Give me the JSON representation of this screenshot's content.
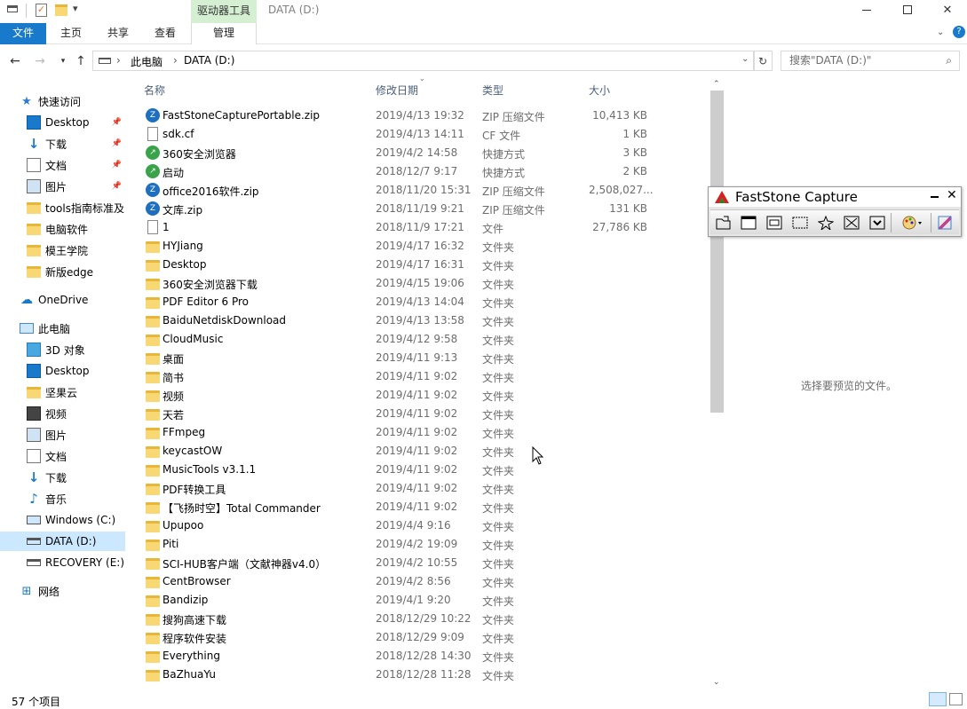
{
  "window": {
    "title": "DATA (D:)",
    "context_tab": "驱动器工具",
    "controls": {
      "minimize": "—",
      "maximize": "☐",
      "close": "✕"
    }
  },
  "ribbon": {
    "tabs": [
      "文件",
      "主页",
      "共享",
      "查看",
      "管理"
    ],
    "accent": "#1979ca"
  },
  "address": {
    "path": [
      "此电脑",
      "DATA (D:)"
    ],
    "search_placeholder": "搜索\"DATA (D:)\""
  },
  "nav": {
    "items": [
      {
        "label": "快速访问",
        "icon": "star-icon"
      },
      {
        "label": "Desktop",
        "icon": "desktop-icon",
        "pinned": true
      },
      {
        "label": "下载",
        "icon": "download-icon",
        "pinned": true
      },
      {
        "label": "文档",
        "icon": "document-icon",
        "pinned": true
      },
      {
        "label": "图片",
        "icon": "picture-icon",
        "pinned": true
      },
      {
        "label": "tools指南标准及",
        "icon": "folder-icon"
      },
      {
        "label": "电脑软件",
        "icon": "folder-icon"
      },
      {
        "label": "模王学院",
        "icon": "folder-icon"
      },
      {
        "label": "新版edge",
        "icon": "folder-icon"
      },
      {
        "label": "OneDrive",
        "icon": "cloud-icon"
      },
      {
        "label": "此电脑",
        "icon": "computer-icon"
      },
      {
        "label": "3D 对象",
        "icon": "cube-icon"
      },
      {
        "label": "Desktop",
        "icon": "desktop-icon"
      },
      {
        "label": "坚果云",
        "icon": "folder-icon"
      },
      {
        "label": "视频",
        "icon": "video-icon"
      },
      {
        "label": "图片",
        "icon": "picture-icon"
      },
      {
        "label": "文档",
        "icon": "document-icon"
      },
      {
        "label": "下载",
        "icon": "download-icon"
      },
      {
        "label": "音乐",
        "icon": "music-icon"
      },
      {
        "label": "Windows (C:)",
        "icon": "drive-c-icon"
      },
      {
        "label": "DATA (D:)",
        "icon": "drive-icon",
        "selected": true
      },
      {
        "label": "RECOVERY (E:)",
        "icon": "drive-icon"
      },
      {
        "label": "网络",
        "icon": "network-icon"
      }
    ]
  },
  "columns": {
    "name": "名称",
    "date": "修改日期",
    "type": "类型",
    "size": "大小"
  },
  "files": [
    {
      "name": "FastStoneCapturePortable.zip",
      "date": "2019/4/13 19:32",
      "type": "ZIP 压缩文件",
      "size": "10,413 KB",
      "kind": "zip"
    },
    {
      "name": "sdk.cf",
      "date": "2019/4/13 14:11",
      "type": "CF 文件",
      "size": "1 KB",
      "kind": "file"
    },
    {
      "name": "360安全浏览器",
      "date": "2019/4/2 14:58",
      "type": "快捷方式",
      "size": "3 KB",
      "kind": "shortcut"
    },
    {
      "name": "启动",
      "date": "2018/12/7 9:17",
      "type": "快捷方式",
      "size": "2 KB",
      "kind": "shortcut"
    },
    {
      "name": "office2016软件.zip",
      "date": "2018/11/20 15:31",
      "type": "ZIP 压缩文件",
      "size": "2,508,027...",
      "kind": "zip"
    },
    {
      "name": "文库.zip",
      "date": "2018/11/19 9:21",
      "type": "ZIP 压缩文件",
      "size": "131 KB",
      "kind": "zip"
    },
    {
      "name": "1",
      "date": "2018/11/9 17:21",
      "type": "文件",
      "size": "27,786 KB",
      "kind": "file"
    },
    {
      "name": "HYJiang",
      "date": "2019/4/17 16:32",
      "type": "文件夹",
      "size": "",
      "kind": "folder"
    },
    {
      "name": "Desktop",
      "date": "2019/4/17 16:31",
      "type": "文件夹",
      "size": "",
      "kind": "folder"
    },
    {
      "name": "360安全浏览器下载",
      "date": "2019/4/15 19:06",
      "type": "文件夹",
      "size": "",
      "kind": "folder"
    },
    {
      "name": "PDF Editor 6 Pro",
      "date": "2019/4/13 14:04",
      "type": "文件夹",
      "size": "",
      "kind": "folder"
    },
    {
      "name": "BaiduNetdiskDownload",
      "date": "2019/4/13 13:58",
      "type": "文件夹",
      "size": "",
      "kind": "folder"
    },
    {
      "name": "CloudMusic",
      "date": "2019/4/12 9:58",
      "type": "文件夹",
      "size": "",
      "kind": "folder"
    },
    {
      "name": "桌面",
      "date": "2019/4/11 9:13",
      "type": "文件夹",
      "size": "",
      "kind": "folder"
    },
    {
      "name": "简书",
      "date": "2019/4/11 9:02",
      "type": "文件夹",
      "size": "",
      "kind": "folder"
    },
    {
      "name": "视频",
      "date": "2019/4/11 9:02",
      "type": "文件夹",
      "size": "",
      "kind": "folder"
    },
    {
      "name": "天若",
      "date": "2019/4/11 9:02",
      "type": "文件夹",
      "size": "",
      "kind": "folder"
    },
    {
      "name": "FFmpeg",
      "date": "2019/4/11 9:02",
      "type": "文件夹",
      "size": "",
      "kind": "folder"
    },
    {
      "name": "keycastOW",
      "date": "2019/4/11 9:02",
      "type": "文件夹",
      "size": "",
      "kind": "folder"
    },
    {
      "name": "MusicTools v3.1.1",
      "date": "2019/4/11 9:02",
      "type": "文件夹",
      "size": "",
      "kind": "folder"
    },
    {
      "name": "PDF转换工具",
      "date": "2019/4/11 9:02",
      "type": "文件夹",
      "size": "",
      "kind": "folder"
    },
    {
      "name": "【飞扬时空】Total Commander",
      "date": "2019/4/11 9:02",
      "type": "文件夹",
      "size": "",
      "kind": "folder"
    },
    {
      "name": "Upupoo",
      "date": "2019/4/4 9:16",
      "type": "文件夹",
      "size": "",
      "kind": "folder"
    },
    {
      "name": "Piti",
      "date": "2019/4/2 19:09",
      "type": "文件夹",
      "size": "",
      "kind": "folder"
    },
    {
      "name": "SCI-HUB客户端（文献神器v4.0）",
      "date": "2019/4/2 10:55",
      "type": "文件夹",
      "size": "",
      "kind": "folder"
    },
    {
      "name": "CentBrowser",
      "date": "2019/4/2 8:56",
      "type": "文件夹",
      "size": "",
      "kind": "folder"
    },
    {
      "name": "Bandizip",
      "date": "2019/4/1 9:20",
      "type": "文件夹",
      "size": "",
      "kind": "folder"
    },
    {
      "name": "搜狗高速下载",
      "date": "2018/12/29 10:22",
      "type": "文件夹",
      "size": "",
      "kind": "folder"
    },
    {
      "name": "程序软件安装",
      "date": "2018/12/29 9:09",
      "type": "文件夹",
      "size": "",
      "kind": "folder"
    },
    {
      "name": "Everything",
      "date": "2018/12/28 14:30",
      "type": "文件夹",
      "size": "",
      "kind": "folder"
    },
    {
      "name": "BaZhuaYu",
      "date": "2018/12/28 11:28",
      "type": "文件夹",
      "size": "",
      "kind": "folder"
    }
  ],
  "preview": {
    "message": "选择要预览的文件。"
  },
  "status": {
    "count": "57 个项目"
  },
  "faststone": {
    "title": "FastStone Capture",
    "tools": [
      "open-icon",
      "window-capture-icon",
      "object-capture-icon",
      "rect-capture-icon",
      "freehand-capture-icon",
      "fullscreen-capture-icon",
      "scroll-capture-icon",
      "output-color-icon",
      "settings-icon"
    ]
  }
}
